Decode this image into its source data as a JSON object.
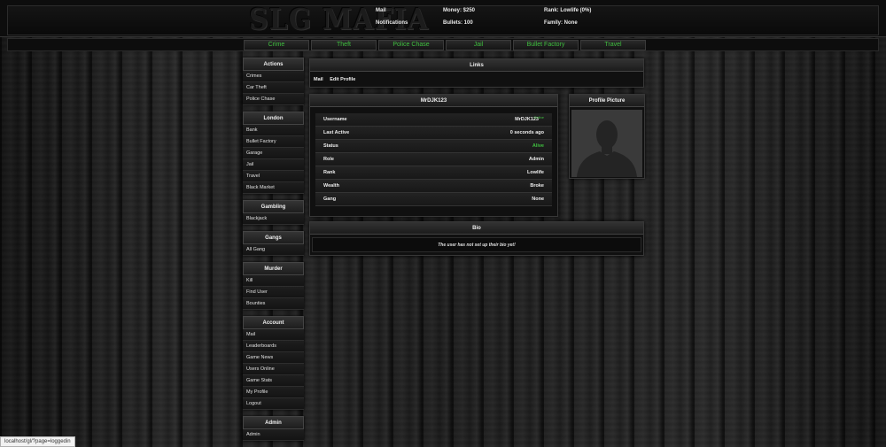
{
  "header": {
    "logo": "SLG MAFIA",
    "mail": "Mail",
    "notifications": "Notifications",
    "money": "Money: $250",
    "bullets": "Bullets: 100",
    "rank": "Rank: Lowlife (0%)",
    "family": "Family: None"
  },
  "nav": [
    "Crime",
    "Theft",
    "Police Chase",
    "Jail",
    "Bullet Factory",
    "Travel"
  ],
  "sidebar": [
    {
      "title": "Actions",
      "items": [
        "Crimes",
        "Car Theft",
        "Police Chase"
      ]
    },
    {
      "title": "London",
      "items": [
        "Bank",
        "Bullet Factory",
        "Garage",
        "Jail",
        "Travel",
        "Black Market"
      ]
    },
    {
      "title": "Gambling",
      "items": [
        "Blackjack"
      ]
    },
    {
      "title": "Gangs",
      "items": [
        "All Gang"
      ]
    },
    {
      "title": "Murder",
      "items": [
        "Kill",
        "Find User",
        "Bounties"
      ]
    },
    {
      "title": "Account",
      "items": [
        "Mail",
        "Leaderboards",
        "Game News",
        "Users Online",
        "Game Stats",
        "My Profile",
        "Logout"
      ]
    },
    {
      "title": "Admin",
      "items": [
        "Admin"
      ]
    }
  ],
  "links": {
    "title": "Links",
    "items": [
      "Mail",
      "Edit Profile"
    ]
  },
  "profile": {
    "title": "MrDJK123",
    "online_tag": "Online",
    "rows": [
      {
        "label": "Username",
        "value": "MrDJK123"
      },
      {
        "label": "Last Active",
        "value": "0 seconds ago"
      },
      {
        "label": "Status",
        "value": "Alive"
      },
      {
        "label": "Role",
        "value": "Admin"
      },
      {
        "label": "Rank",
        "value": "Lowlife"
      },
      {
        "label": "Wealth",
        "value": "Broke"
      },
      {
        "label": "Gang",
        "value": "None"
      }
    ]
  },
  "picture": {
    "title": "Profile Picture"
  },
  "bio": {
    "title": "Bio",
    "text": "The user has not set up their bio yet!"
  },
  "statusbar": "localhost/gl/?page=loggedin",
  "colors": {
    "accent_green": "#3fbf3f",
    "panel": "#101010"
  }
}
